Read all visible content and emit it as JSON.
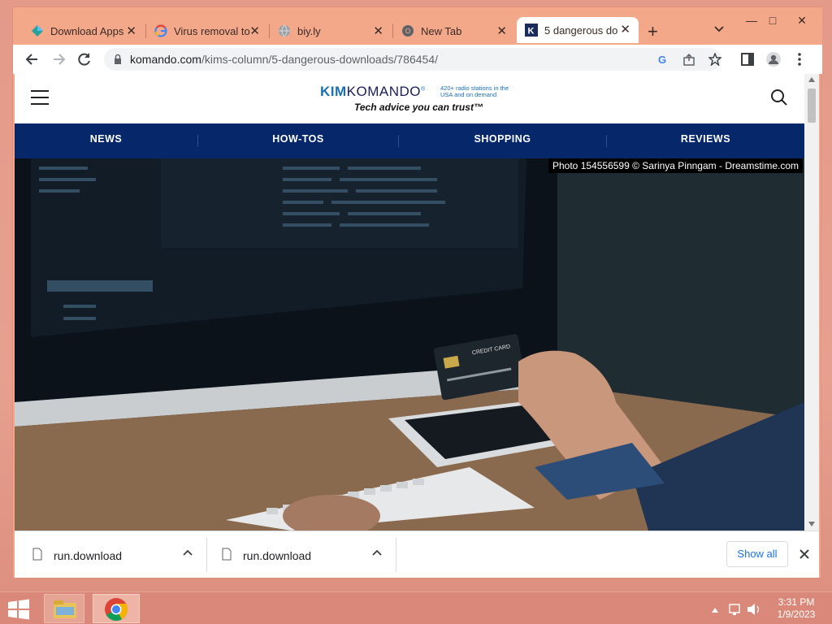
{
  "browser": {
    "tabs": [
      {
        "title": "Download Apps",
        "favicon": "diamond-app-icon"
      },
      {
        "title": "Virus removal to",
        "favicon": "google-g-icon"
      },
      {
        "title": "biy.ly",
        "favicon": "globe-icon"
      },
      {
        "title": "New Tab",
        "favicon": "chrome-icon"
      },
      {
        "title": "5 dangerous do",
        "favicon": "kim-komando-icon",
        "active": true
      }
    ],
    "tab_close_glyph": "✕",
    "new_tab_glyph": "+",
    "window_controls": {
      "minimize": "—",
      "maximize": "□",
      "close": "✕"
    },
    "url": {
      "domain": "komando.com",
      "path": "/kims-column/5-dangerous-downloads/786454/"
    }
  },
  "site": {
    "logo": {
      "kim": "KIM",
      "komando": "KOMANDO",
      "reg": "®",
      "stations": "420+ radio stations in the USA and on demand",
      "tagline": "Tech advice you can trust™"
    },
    "nav": [
      "NEWS",
      "HOW-TOS",
      "SHOPPING",
      "REVIEWS"
    ],
    "hero": {
      "photo_credit": "Photo 154556599 © Sarinya Pinngam - Dreamstime.com",
      "card_text": "CREDIT CARD"
    }
  },
  "downloads": {
    "items": [
      {
        "name": "run.download"
      },
      {
        "name": "run.download"
      }
    ],
    "show_all": "Show all"
  },
  "taskbar": {
    "time": "3:31 PM",
    "date": "1/9/2023"
  }
}
